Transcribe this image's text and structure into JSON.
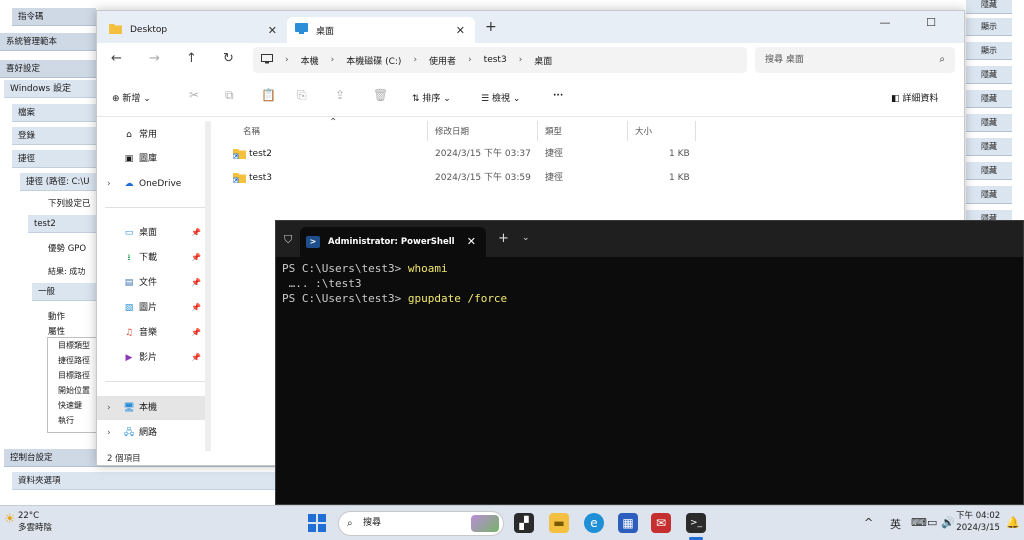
{
  "background_report": {
    "rows": [
      "指令碼",
      "系統管理範本",
      "喜好設定",
      "Windows 設定",
      "檔案",
      "登錄",
      "捷徑",
      "捷徑 (路徑: C:\\U",
      "下列設定已",
      "test2",
      "優勢 GPO",
      "結果: 成功",
      "一般",
      "動作",
      "屬性",
      "控制台設定",
      "資料夾選項"
    ],
    "properties": [
      "目標類型",
      "捷徑路徑",
      "目標路徑",
      "開始位置",
      "快速鍵",
      "執行"
    ],
    "right_labels": [
      "隱藏",
      "顯示",
      "顯示",
      "隱藏",
      "隱藏",
      "隱藏",
      "隱藏",
      "隱藏",
      "隱藏",
      "隱藏"
    ]
  },
  "explorer": {
    "tabs": [
      {
        "label": "Desktop"
      },
      {
        "label": "桌面"
      }
    ],
    "new_tab": "+",
    "window_controls": {
      "minimize": "—",
      "maximize": "☐",
      "close": "✕"
    },
    "nav": {
      "back": "←",
      "forward": "→",
      "up": "↑",
      "refresh": "↻"
    },
    "breadcrumb": [
      "本機",
      "本機磁碟 (C:)",
      "使用者",
      "test3",
      "桌面"
    ],
    "search_placeholder": "搜尋 桌面",
    "commands": {
      "new": "新增",
      "sort": "排序",
      "view": "檢視",
      "more": "···",
      "details": "詳細資料"
    },
    "sidebar": {
      "top": [
        {
          "label": "常用",
          "icon": "home-icon"
        },
        {
          "label": "圖庫",
          "icon": "gallery-icon"
        },
        {
          "label": "OneDrive",
          "icon": "cloud-icon"
        }
      ],
      "pinned": [
        {
          "label": "桌面",
          "icon": "desktop-icon"
        },
        {
          "label": "下載",
          "icon": "download-icon"
        },
        {
          "label": "文件",
          "icon": "documents-icon"
        },
        {
          "label": "圖片",
          "icon": "pictures-icon"
        },
        {
          "label": "音樂",
          "icon": "music-icon"
        },
        {
          "label": "影片",
          "icon": "videos-icon"
        }
      ],
      "bottom": [
        {
          "label": "本機",
          "icon": "computer-icon"
        },
        {
          "label": "網路",
          "icon": "network-icon"
        }
      ]
    },
    "columns": {
      "name": "名稱",
      "modified": "修改日期",
      "type": "類型",
      "size": "大小"
    },
    "files": [
      {
        "name": "test2",
        "modified": "2024/3/15 下午 03:37",
        "type": "捷徑",
        "size": "1 KB"
      },
      {
        "name": "test3",
        "modified": "2024/3/15 下午 03:59",
        "type": "捷徑",
        "size": "1 KB"
      }
    ],
    "status": "2 個項目"
  },
  "terminal": {
    "tab_title": "Administrator: PowerShell",
    "lines": [
      {
        "prompt": "PS C:\\Users\\test3> ",
        "command": "whoami"
      },
      {
        "prompt": " ….. :\\test3",
        "command": ""
      },
      {
        "prompt": "PS C:\\Users\\test3> ",
        "command": "gpupdate /force"
      }
    ]
  },
  "taskbar": {
    "weather_temp": "22°C",
    "weather_desc": "多雲時陰",
    "search_label": "搜尋",
    "ime": "英",
    "time": "下午 04:02",
    "date": "2024/3/15",
    "tray_chevron": "^"
  },
  "colors": {
    "accent": "#1f6fd6",
    "terminal_bg": "#0c0c0c",
    "command_yellow": "#f2e86d",
    "folder_yellow": "#f3c03f"
  }
}
